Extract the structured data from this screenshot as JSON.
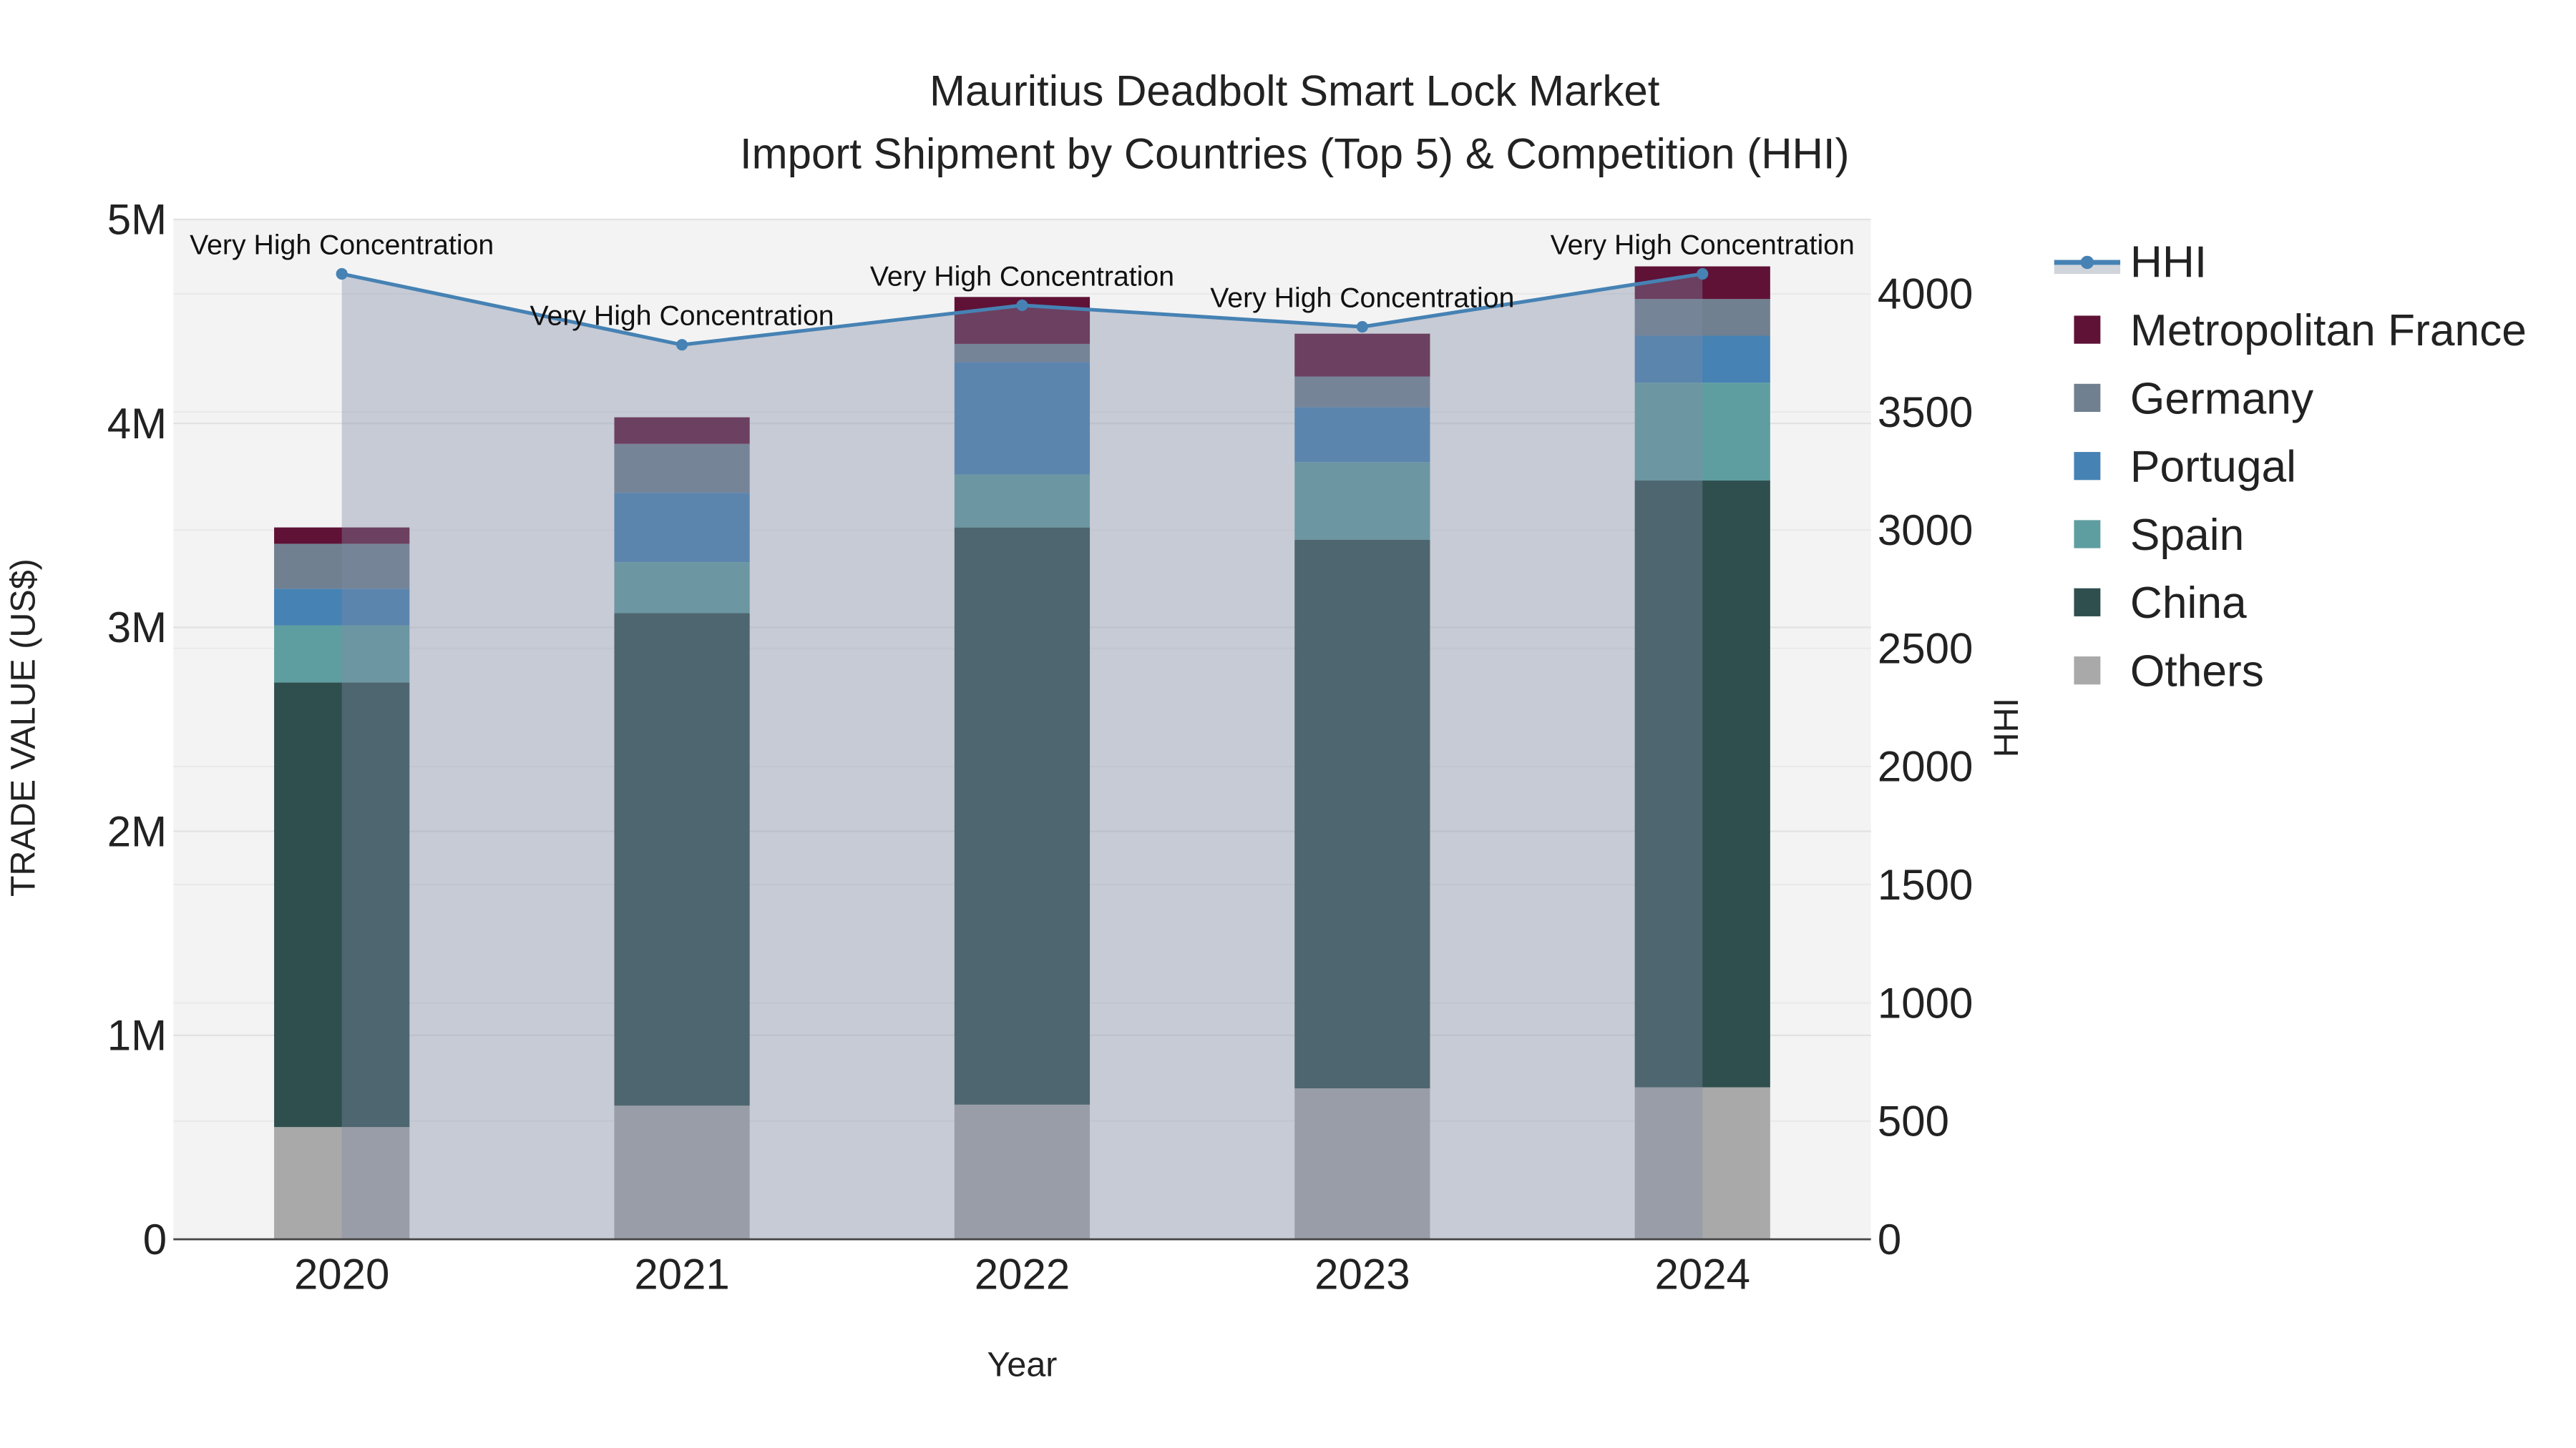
{
  "chart_data": {
    "type": "bar",
    "title": [
      "Mauritius Deadbolt Smart Lock Market",
      "Import Shipment by Countries (Top 5) & Competition (HHI)"
    ],
    "xlabel": "Year",
    "ylabel": "TRADE VALUE (US$)",
    "y2label": "HHI",
    "categories": [
      "2020",
      "2021",
      "2022",
      "2023",
      "2024"
    ],
    "ylim": [
      0,
      5000000
    ],
    "y_ticks": [
      0,
      1000000,
      2000000,
      3000000,
      4000000,
      5000000
    ],
    "y_tick_labels": [
      "0",
      "1M",
      "2M",
      "3M",
      "4M",
      "5M"
    ],
    "y2lim": [
      0,
      4310
    ],
    "y2_ticks": [
      0,
      500,
      1000,
      1500,
      2000,
      2500,
      3000,
      3500,
      4000
    ],
    "y2_tick_labels": [
      "0",
      "500",
      "1000",
      "1500",
      "2000",
      "2500",
      "3000",
      "3500",
      "4000"
    ],
    "stacked": true,
    "series": [
      {
        "name": "Others",
        "color": "#a9a9a9",
        "values": [
          550000,
          655000,
          660000,
          740000,
          745000
        ]
      },
      {
        "name": "China",
        "color": "#2f4f4f",
        "values": [
          2180000,
          2415000,
          2830000,
          2690000,
          2975000
        ]
      },
      {
        "name": "Spain",
        "color": "#5f9ea0",
        "values": [
          280000,
          250000,
          260000,
          380000,
          480000
        ]
      },
      {
        "name": "Portugal",
        "color": "#4682b4",
        "values": [
          180000,
          340000,
          550000,
          270000,
          230000
        ]
      },
      {
        "name": "Germany",
        "color": "#708090",
        "values": [
          220000,
          240000,
          90000,
          150000,
          180000
        ]
      },
      {
        "name": "Metropolitan France",
        "color": "#5f1236",
        "values": [
          80000,
          130000,
          230000,
          210000,
          160000
        ]
      }
    ],
    "line": {
      "name": "HHI",
      "color": "#4682b4",
      "axis": "right",
      "values": [
        4084,
        3784,
        3951,
        3860,
        4084
      ],
      "annotations": [
        "Very High Concentration",
        "Very High Concentration",
        "Very High Concentration",
        "Very High Concentration",
        "Very High Concentration"
      ]
    },
    "legend": {
      "placement": "right",
      "order": [
        "HHI",
        "Metropolitan France",
        "Germany",
        "Portugal",
        "Spain",
        "China",
        "Others"
      ]
    },
    "grid": true
  }
}
